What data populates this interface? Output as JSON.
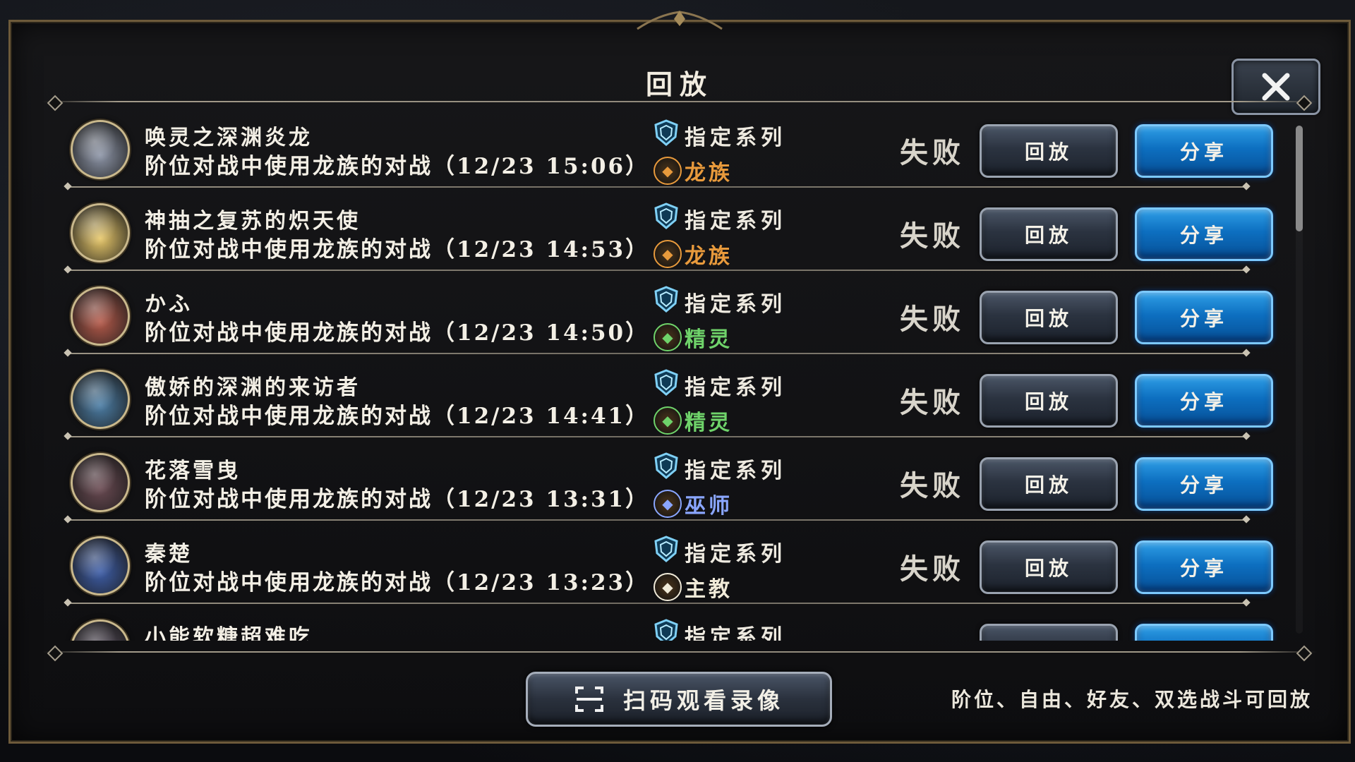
{
  "dialog": {
    "title": "回放",
    "close_icon": "close-icon"
  },
  "replays": [
    {
      "player_name": "唤灵之深渊炎龙",
      "match_desc": "阶位对战中使用龙族的对战（12/23 15:06）",
      "format": "指定系列",
      "class_name": "龙族",
      "class_color": "#e89a3c",
      "class_icon": "dragon-class-icon",
      "result": "失败",
      "replay_label": "回放",
      "share_label": "分享",
      "avatar_color": "#8e96a8"
    },
    {
      "player_name": "神抽之复苏的炽天使",
      "match_desc": "阶位对战中使用龙族的对战（12/23 14:53）",
      "format": "指定系列",
      "class_name": "龙族",
      "class_color": "#e89a3c",
      "class_icon": "dragon-class-icon",
      "result": "失败",
      "replay_label": "回放",
      "share_label": "分享",
      "avatar_color": "#e8c86a"
    },
    {
      "player_name": "かふ",
      "match_desc": "阶位对战中使用龙族的对战（12/23 14:50）",
      "format": "指定系列",
      "class_name": "精灵",
      "class_color": "#6fd36a",
      "class_icon": "forest-class-icon",
      "result": "失败",
      "replay_label": "回放",
      "share_label": "分享",
      "avatar_color": "#b55a4a"
    },
    {
      "player_name": "傲娇的深渊的来访者",
      "match_desc": "阶位对战中使用龙族的对战（12/23 14:41）",
      "format": "指定系列",
      "class_name": "精灵",
      "class_color": "#6fd36a",
      "class_icon": "forest-class-icon",
      "result": "失败",
      "replay_label": "回放",
      "share_label": "分享",
      "avatar_color": "#4c7ea6"
    },
    {
      "player_name": "花落雪曳",
      "match_desc": "阶位对战中使用龙族的对战（12/23 13:31）",
      "format": "指定系列",
      "class_name": "巫师",
      "class_color": "#8aa6ff",
      "class_icon": "rune-class-icon",
      "result": "失败",
      "replay_label": "回放",
      "share_label": "分享",
      "avatar_color": "#6a4a52"
    },
    {
      "player_name": "秦楚",
      "match_desc": "阶位对战中使用龙族的对战（12/23 13:23）",
      "format": "指定系列",
      "class_name": "主教",
      "class_color": "#f0ead8",
      "class_icon": "haven-class-icon",
      "result": "失败",
      "replay_label": "回放",
      "share_label": "分享",
      "avatar_color": "#3e5ea8"
    },
    {
      "player_name": "小能软糖超难吃",
      "match_desc": "",
      "format": "指定系列",
      "class_name": "",
      "class_color": "#e8e4da",
      "class_icon": "class-icon",
      "result": "",
      "replay_label": "",
      "share_label": "",
      "avatar_color": "#5a5060"
    }
  ],
  "footer": {
    "scan_label": "扫码观看录像",
    "scan_icon": "scan-icon",
    "note": "阶位、自由、好友、双选战斗可回放"
  }
}
